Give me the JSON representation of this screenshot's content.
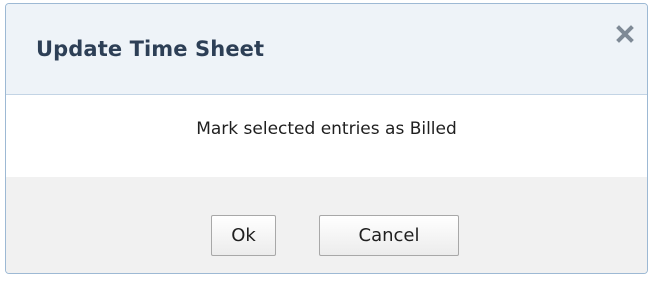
{
  "dialog": {
    "title": "Update Time Sheet",
    "close_icon": "close-icon",
    "message": "Mark selected entries as Billed",
    "buttons": {
      "ok_label": "Ok",
      "cancel_label": "Cancel"
    }
  },
  "colors": {
    "title_text": "#2d3f56",
    "titlebar_bg": "#eef3f8",
    "border": "#9db9d4",
    "footer_bg": "#f1f1f1",
    "close_icon": "#7f8a96"
  }
}
